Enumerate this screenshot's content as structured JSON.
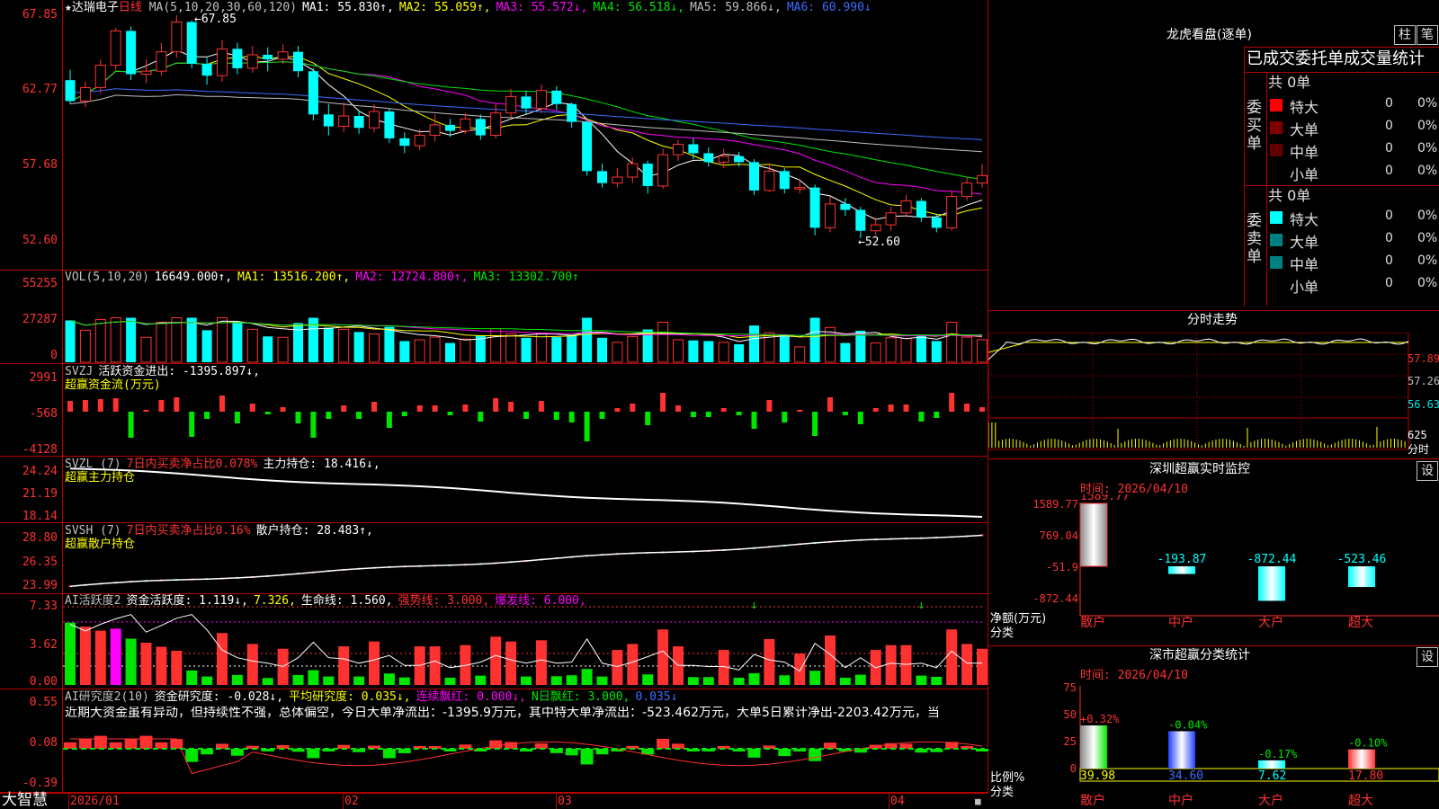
{
  "stock": {
    "name": "达瑞电子",
    "period": "日线",
    "star": "★"
  },
  "ma_legend": [
    {
      "text": "MA(5,10,20,30,60,120)",
      "color": "#c0c0c0"
    },
    {
      "text": "MA1: 55.830↑,",
      "color": "#ffffff"
    },
    {
      "text": "MA2: 55.059↑,",
      "color": "#ffff00"
    },
    {
      "text": "MA3: 55.572↓,",
      "color": "#ff00ff"
    },
    {
      "text": "MA4: 56.518↓,",
      "color": "#00e600"
    },
    {
      "text": "MA5: 59.866↓,",
      "color": "#c0c0c0"
    },
    {
      "text": "MA6: 60.990↓",
      "color": "#3c6cff"
    }
  ],
  "price_axis": [
    "67.85",
    "62.77",
    "57.68",
    "52.60"
  ],
  "price_high_label": "←67.85",
  "price_low_label": "←52.60",
  "vol": {
    "legend": [
      {
        "text": "VOL(5,10,20)",
        "color": "#c0c0c0"
      },
      {
        "text": "16649.000↑,",
        "color": "#ffffff"
      },
      {
        "text": "MA1: 13516.200↑,",
        "color": "#ffff00"
      },
      {
        "text": "MA2: 12724.800↑,",
        "color": "#ff00ff"
      },
      {
        "text": "MA3: 13302.700↑",
        "color": "#00e600"
      }
    ],
    "axis": [
      "55255",
      "27287",
      "0"
    ]
  },
  "svzj": {
    "legend": [
      {
        "text": "SVZJ",
        "color": "#c0c0c0"
      },
      {
        "text": "活跃资金进出: -1395.897↓,",
        "color": "#ffffff"
      }
    ],
    "sub": "超赢资金流(万元)",
    "axis": [
      "2991",
      "-568",
      "-4128"
    ]
  },
  "svzl": {
    "legend": [
      {
        "text": "SVZL (7)",
        "color": "#c0c0c0"
      },
      {
        "text": "7日内买卖净占比0.078%",
        "color": "#ff3232"
      },
      {
        "text": "主力持仓: 18.416↓,",
        "color": "#ffffff"
      }
    ],
    "sub": "超赢主力持仓",
    "axis": [
      "24.24",
      "21.19",
      "18.14"
    ]
  },
  "svsh": {
    "legend": [
      {
        "text": "SVSH (7)",
        "color": "#c0c0c0"
      },
      {
        "text": "7日内买卖净占比0.16%",
        "color": "#ff3232"
      },
      {
        "text": "散户持仓: 28.483↑,",
        "color": "#ffffff"
      }
    ],
    "sub": "超赢散户持仓",
    "axis": [
      "28.80",
      "26.35",
      "23.99"
    ]
  },
  "ai_active": {
    "legend": [
      {
        "text": "AI活跃度2",
        "color": "#c0c0c0"
      },
      {
        "text": "资金活跃度: 1.119↓,",
        "color": "#ffffff"
      },
      {
        "text": "7.326,",
        "color": "#ffff00"
      },
      {
        "text": "生命线: 1.560,",
        "color": "#ffffff"
      },
      {
        "text": "强势线: 3.000,",
        "color": "#ff3232"
      },
      {
        "text": "爆发线: 6.000,",
        "color": "#ff00ff"
      }
    ],
    "axis": [
      "7.33",
      "3.62",
      "0.00"
    ]
  },
  "ai_research": {
    "legend": [
      {
        "text": "AI研究度2(10)",
        "color": "#c0c0c0"
      },
      {
        "text": "资金研究度: -0.028↓,",
        "color": "#ffffff"
      },
      {
        "text": "平均研究度: 0.035↓,",
        "color": "#ffff00"
      },
      {
        "text": "连续飘红: 0.000↓,",
        "color": "#ff00ff"
      },
      {
        "text": "N日飘红: 3.000,",
        "color": "#00e600"
      },
      {
        "text": "0.035↓",
        "color": "#3c6cff"
      }
    ],
    "text": "近期大资金虽有异动，但持续性不强，总体偏空，今日大单净流出：-1395.9万元，其中特大单净流出：-523.462万元，大单5日累计净出-2203.42万元，当",
    "axis": [
      "0.55",
      "0.08",
      "-0.39"
    ]
  },
  "date_axis": [
    "2026/01",
    "02",
    "03",
    "04"
  ],
  "brand": "大智慧",
  "lhb": {
    "title": "龙虎看盘(逐单)",
    "btn1": "柱",
    "btn2": "笔",
    "header": "已成交委托单成交量统计",
    "buy_label": "委买单",
    "sell_label": "委卖单",
    "buy_total": "共 0单",
    "sell_total": "共 0单",
    "buy_rows": [
      {
        "name": "特大",
        "count": "0",
        "pct": "0%",
        "color": "#ff0000"
      },
      {
        "name": "大单",
        "count": "0",
        "pct": "0%",
        "color": "#800000"
      },
      {
        "name": "中单",
        "count": "0",
        "pct": "0%",
        "color": "#600000"
      },
      {
        "name": "小单",
        "count": "0",
        "pct": "0%",
        "color": "#000000"
      }
    ],
    "sell_rows": [
      {
        "name": "特大",
        "count": "0",
        "pct": "0%",
        "color": "#00ffff"
      },
      {
        "name": "大单",
        "count": "0",
        "pct": "0%",
        "color": "#008080"
      },
      {
        "name": "中单",
        "count": "0",
        "pct": "0%",
        "color": "#008080"
      },
      {
        "name": "小单",
        "count": "0",
        "pct": "0%",
        "color": "#000000"
      }
    ]
  },
  "intraday": {
    "title": "分时走势",
    "axis": [
      "57.89",
      "57.26",
      "56.63"
    ],
    "vol_axis": [
      "625",
      "分时"
    ]
  },
  "sz_monitor": {
    "title": "深圳超赢实时监控",
    "btn": "设",
    "time": "时间: 2026/04/10",
    "axis": [
      "1589.77",
      "769.04",
      "-51.9",
      "-872.44"
    ],
    "unit": "净额(万元)",
    "cat_label": "分类",
    "bars": [
      {
        "name": "散户",
        "value": 1589.77,
        "label": "1589.77"
      },
      {
        "name": "中户",
        "value": -193.87,
        "label": "-193.87"
      },
      {
        "name": "大户",
        "value": -872.44,
        "label": "-872.44"
      },
      {
        "name": "超大",
        "value": -523.46,
        "label": "-523.46"
      }
    ]
  },
  "sz_class": {
    "title": "深市超赢分类统计",
    "btn": "设",
    "time": "时间: 2026/04/10",
    "axis": [
      "75",
      "50",
      "25",
      "0"
    ],
    "unit": "比例%",
    "cat_label": "分类",
    "bars": [
      {
        "name": "散户",
        "value": 39.98,
        "delta": "+0.32%",
        "label": "39.98"
      },
      {
        "name": "中户",
        "value": 34.6,
        "delta": "-0.04%",
        "label": "34.60"
      },
      {
        "name": "大户",
        "value": 7.62,
        "delta": "-0.17%",
        "label": "7.62"
      },
      {
        "name": "超大",
        "value": 17.8,
        "delta": "-0.10%",
        "label": "17.80"
      }
    ]
  },
  "chart_data": {
    "type": "candlestick",
    "title": "达瑞电子 日线",
    "ylim": [
      52.6,
      67.85
    ],
    "candles": [
      [
        63.5,
        62.1,
        64.2,
        61.9
      ],
      [
        62.1,
        63.0,
        63.4,
        61.7
      ],
      [
        63.0,
        64.5,
        64.9,
        62.6
      ],
      [
        64.5,
        66.8,
        67.0,
        64.2
      ],
      [
        66.8,
        63.9,
        67.1,
        63.5
      ],
      [
        63.9,
        64.1,
        64.9,
        63.3
      ],
      [
        64.1,
        65.4,
        66.0,
        63.8
      ],
      [
        65.4,
        67.4,
        67.85,
        65.0
      ],
      [
        67.4,
        64.6,
        67.5,
        64.3
      ],
      [
        64.6,
        63.8,
        65.0,
        63.2
      ],
      [
        63.8,
        65.6,
        66.2,
        63.4
      ],
      [
        65.6,
        64.3,
        66.0,
        63.9
      ],
      [
        64.3,
        65.2,
        65.8,
        64.0
      ],
      [
        65.2,
        64.9,
        65.7,
        64.1
      ],
      [
        64.9,
        65.4,
        65.9,
        64.6
      ],
      [
        65.4,
        64.1,
        65.8,
        63.7
      ],
      [
        64.1,
        61.2,
        64.3,
        60.8
      ],
      [
        61.2,
        60.4,
        61.9,
        59.8
      ],
      [
        60.4,
        61.1,
        62.0,
        60.0
      ],
      [
        61.1,
        60.3,
        61.5,
        59.9
      ],
      [
        60.3,
        61.4,
        61.9,
        60.0
      ],
      [
        61.4,
        59.6,
        61.6,
        59.3
      ],
      [
        59.6,
        59.1,
        60.0,
        58.6
      ],
      [
        59.1,
        59.8,
        60.2,
        58.8
      ],
      [
        59.8,
        60.5,
        61.2,
        59.4
      ],
      [
        60.5,
        60.1,
        60.9,
        59.7
      ],
      [
        60.1,
        60.9,
        61.3,
        59.9
      ],
      [
        60.9,
        59.8,
        61.2,
        59.5
      ],
      [
        59.8,
        61.3,
        61.9,
        59.6
      ],
      [
        61.3,
        62.4,
        62.9,
        61.0
      ],
      [
        62.4,
        61.6,
        62.8,
        61.2
      ],
      [
        61.6,
        62.8,
        63.2,
        61.3
      ],
      [
        62.8,
        61.9,
        63.1,
        61.5
      ],
      [
        61.9,
        60.7,
        62.0,
        60.3
      ],
      [
        60.7,
        57.4,
        60.9,
        57.1
      ],
      [
        57.4,
        56.6,
        57.9,
        56.3
      ],
      [
        56.6,
        57.0,
        57.6,
        56.3
      ],
      [
        57.0,
        57.9,
        58.3,
        56.6
      ],
      [
        57.9,
        56.4,
        58.1,
        55.9
      ],
      [
        56.4,
        58.5,
        58.9,
        56.2
      ],
      [
        58.5,
        59.2,
        59.5,
        58.1
      ],
      [
        59.2,
        58.6,
        59.6,
        58.2
      ],
      [
        58.6,
        58.0,
        59.0,
        57.7
      ],
      [
        58.0,
        58.4,
        58.9,
        57.6
      ],
      [
        58.4,
        58.0,
        58.7,
        57.7
      ],
      [
        58.0,
        56.1,
        58.2,
        55.8
      ],
      [
        56.1,
        57.4,
        57.9,
        56.0
      ],
      [
        57.4,
        56.2,
        57.6,
        55.9
      ],
      [
        56.2,
        56.3,
        56.8,
        55.9
      ],
      [
        56.3,
        53.6,
        56.5,
        53.1
      ],
      [
        53.6,
        55.2,
        55.7,
        53.3
      ],
      [
        55.2,
        54.8,
        55.6,
        54.4
      ],
      [
        54.8,
        53.4,
        55.0,
        52.9
      ],
      [
        53.4,
        53.8,
        54.3,
        53.1
      ],
      [
        53.8,
        54.6,
        55.0,
        53.4
      ],
      [
        54.6,
        55.4,
        55.8,
        54.3
      ],
      [
        55.4,
        54.3,
        55.6,
        54.0
      ],
      [
        54.3,
        53.6,
        54.5,
        53.3
      ],
      [
        53.6,
        55.7,
        56.1,
        53.4
      ],
      [
        55.7,
        56.6,
        57.0,
        55.4
      ],
      [
        56.6,
        57.1,
        57.9,
        56.3
      ]
    ]
  }
}
